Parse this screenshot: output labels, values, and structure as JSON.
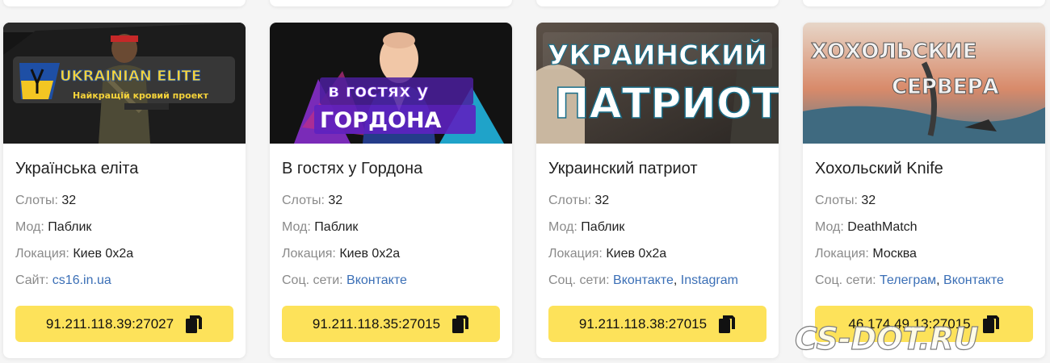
{
  "cards": [
    {
      "banner_text": [
        "UKRAINIAN ELITE",
        "Найкращій кровий проект"
      ],
      "title": "Українська еліта",
      "slots_label": "Слоты:",
      "slots": "32",
      "mod_label": "Мод:",
      "mod": "Паблик",
      "loc_label": "Локация:",
      "loc": "Киев 0x2a",
      "extra_label": "Сайт:",
      "links": [
        "cs16.in.ua"
      ],
      "ip": "91.211.118.39:27027"
    },
    {
      "banner_text": [
        "в гостях у",
        "ГОРДОНА"
      ],
      "title": "В гостях у Гордона",
      "slots_label": "Слоты:",
      "slots": "32",
      "mod_label": "Мод:",
      "mod": "Паблик",
      "loc_label": "Локация:",
      "loc": "Киев 0x2a",
      "extra_label": "Соц. сети:",
      "links": [
        "Вконтакте"
      ],
      "ip": "91.211.118.35:27015"
    },
    {
      "banner_text": [
        "УКРАИНСКИЙ",
        "ПАТРИОТ"
      ],
      "title": "Украинский патриот",
      "slots_label": "Слоты:",
      "slots": "32",
      "mod_label": "Мод:",
      "mod": "Паблик",
      "loc_label": "Локация:",
      "loc": "Киев 0x2a",
      "extra_label": "Соц. сети:",
      "links": [
        "Вконтакте",
        "Instagram"
      ],
      "ip": "91.211.118.38:27015"
    },
    {
      "banner_text": [
        "ХОХОЛЬСКИЕ",
        "СЕРВЕРА"
      ],
      "title": "Хохольский Knife",
      "slots_label": "Слоты:",
      "slots": "32",
      "mod_label": "Мод:",
      "mod": "DeathMatch",
      "loc_label": "Локация:",
      "loc": "Москва",
      "extra_label": "Соц. сети:",
      "links": [
        "Телеграм",
        "Вконтакте"
      ],
      "ip": "46.174.49.13:27015"
    }
  ],
  "link_separator": ", ",
  "watermark": "CS-DOT.RU",
  "colors": {
    "button": "#fde25a",
    "link": "#3b6fb6",
    "label": "#8a8a8a"
  },
  "icons": {
    "copy": "copy-icon"
  }
}
